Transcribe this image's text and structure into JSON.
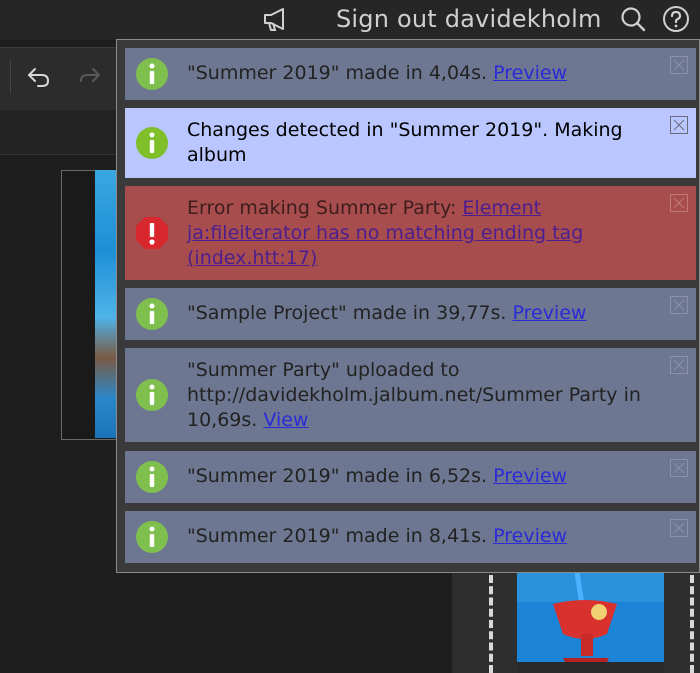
{
  "header": {
    "signout_text": "Sign out davidekholm"
  },
  "icons": {
    "megaphone": "megaphone-icon",
    "search": "search-icon",
    "help": "help-icon",
    "undo": "undo-icon",
    "redo": "redo-icon",
    "info": "info-icon",
    "error": "error-icon",
    "close": "close-icon"
  },
  "colors": {
    "info_card": "#6e7791",
    "info_card_highlight": "#b9c6ff",
    "error_card": "#a84d4d",
    "info_icon": "#7fbf4d",
    "error_icon": "#d8272d",
    "link": "#2a2ad6"
  },
  "notifications": [
    {
      "type": "info",
      "text": "\"Summer 2019\" made in 4,04s. ",
      "link": "Preview"
    },
    {
      "type": "info-highlight",
      "text": "Changes detected in \"Summer 2019\". Making album",
      "link": ""
    },
    {
      "type": "error",
      "text": "Error making Summer Party: ",
      "link": "Element ja:fileiterator has no matching ending tag (index.htt:17)"
    },
    {
      "type": "info",
      "text": "\"Sample Project\" made in 39,77s. ",
      "link": "Preview"
    },
    {
      "type": "info",
      "text": "\"Summer Party\" uploaded to http://davidekholm.jalbum.net/Summer Party in 10,69s. ",
      "link": "View"
    },
    {
      "type": "info",
      "text": "\"Summer 2019\" made in 6,52s. ",
      "link": "Preview"
    },
    {
      "type": "info",
      "text": "\"Summer 2019\" made in 8,41s. ",
      "link": "Preview"
    }
  ]
}
